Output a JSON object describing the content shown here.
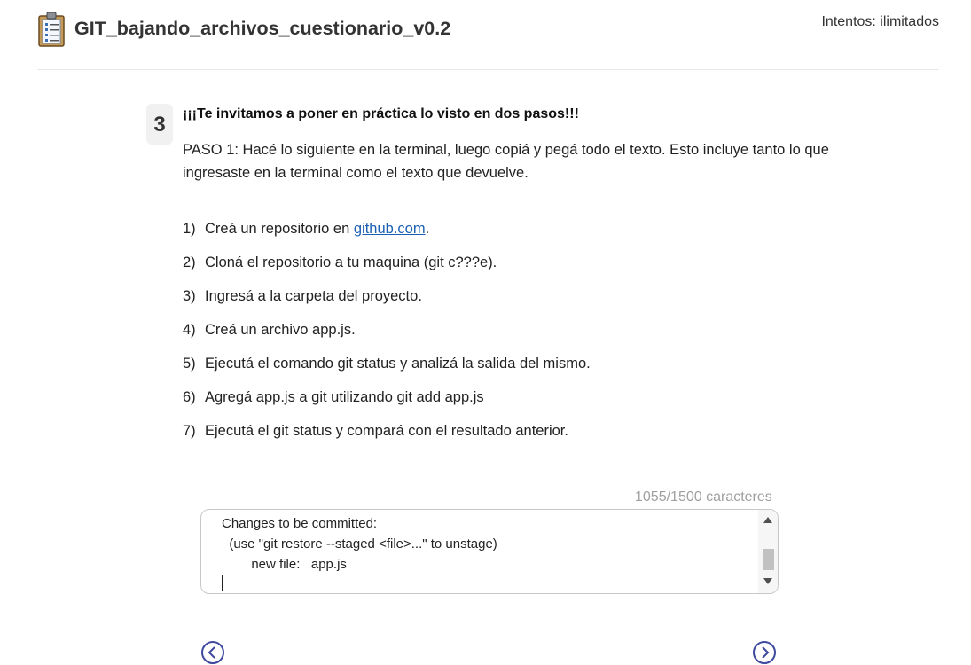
{
  "header": {
    "title": "GIT_bajando_archivos_cuestionario_v0.2",
    "attempts": "Intentos: ilimitados"
  },
  "question": {
    "number": "3",
    "heading": "¡¡¡Te invitamos a poner en práctica lo visto en dos pasos!!!",
    "description": "PASO 1: Hacé lo siguiente en la terminal, luego copiá y pegá todo el texto. Esto incluye tanto lo que ingresaste en la terminal como el texto que devuelve.",
    "steps": [
      {
        "num": "1)",
        "text_before": "Creá un repositorio en ",
        "link": "github.com",
        "text_after": "."
      },
      {
        "num": "2)",
        "text": "Cloná el repositorio a tu maquina (git c???e)."
      },
      {
        "num": "3)",
        "text": "Ingresá a la carpeta del proyecto."
      },
      {
        "num": "4)",
        "text": "Creá un archivo app.js."
      },
      {
        "num": "5)",
        "text": "Ejecutá el comando git status y analizá la salida del mismo."
      },
      {
        "num": "6)",
        "text": "Agregá app.js a git utilizando git add app.js"
      },
      {
        "num": "7)",
        "text": "Ejecutá el git status y compará con el resultado anterior."
      }
    ]
  },
  "answer": {
    "char_count": "1055/1500 caracteres",
    "text": "Changes to be committed:\n  (use \"git restore --staged <file>...\" to unstage)\n        new file:   app.js\n"
  },
  "icons": {
    "quiz": "clipboard-checklist-icon",
    "prev": "chevron-left-circle-icon",
    "next": "chevron-right-circle-icon"
  },
  "colors": {
    "link": "#1a5fb4",
    "nav": "#3d4a9e",
    "counter": "#a0a0a0"
  }
}
